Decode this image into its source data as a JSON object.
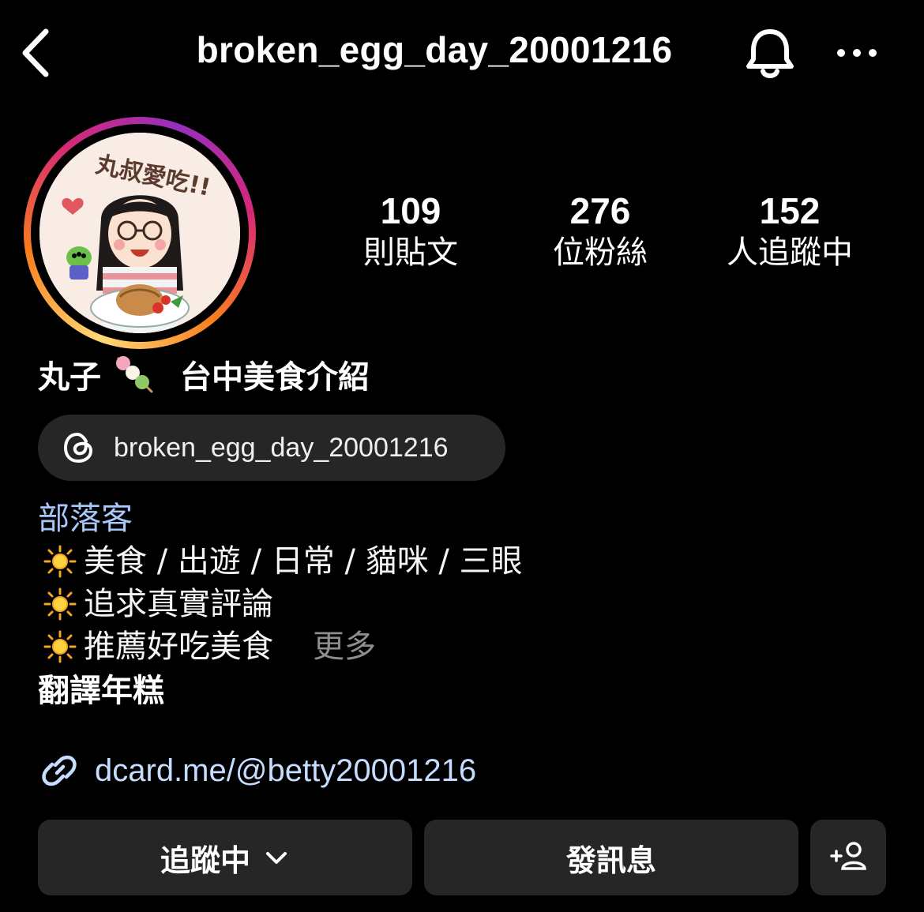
{
  "header": {
    "username": "broken_egg_day_20001216",
    "back_icon": "chevron-left-icon",
    "bell_icon": "bell-icon",
    "more_icon": "more-horizontal-icon"
  },
  "stats": [
    {
      "value": "109",
      "label": "則貼文"
    },
    {
      "value": "276",
      "label": "位粉絲"
    },
    {
      "value": "152",
      "label": "人追蹤中"
    }
  ],
  "profile": {
    "name_part1": "丸子",
    "name_part2": "台中美食介紹",
    "avatar_text": "丸叔愛吃!!",
    "threads_handle": "broken_egg_day_20001216",
    "category": "部落客",
    "bio_lines": [
      "美食 / 出遊 / 日常 / 貓咪 / 三眼",
      "追求真實評論",
      "推薦好吃美食"
    ],
    "more_label": "更多",
    "translate_label": "翻譯年糕",
    "link": "dcard.me/@betty20001216"
  },
  "actions": {
    "following_label": "追蹤中",
    "message_label": "發訊息"
  },
  "colors": {
    "background": "#000000",
    "button_bg": "#262626",
    "link": "#c7ddff",
    "category": "#a8c7fa",
    "muted": "#8e8e8e"
  }
}
